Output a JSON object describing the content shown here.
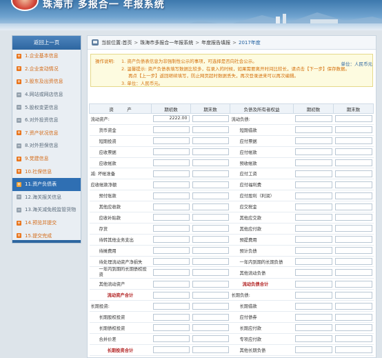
{
  "header": {
    "title": "珠海市 多报合一 年报系统"
  },
  "sidebar": {
    "title": "返回上一页",
    "items": [
      {
        "label": "1.企业基本信息",
        "state": "done"
      },
      {
        "label": "2.企业变动情况",
        "state": "done"
      },
      {
        "label": "3.股东及出资信息",
        "state": "done"
      },
      {
        "label": "4.网站或网店信息",
        "state": "todo"
      },
      {
        "label": "5.股权变更信息",
        "state": "todo"
      },
      {
        "label": "6.对外投资信息",
        "state": "todo"
      },
      {
        "label": "7.资产状况信息",
        "state": "done"
      },
      {
        "label": "8.对外担保信息",
        "state": "todo"
      },
      {
        "label": "9.党建信息",
        "state": "done"
      },
      {
        "label": "10.社保信息",
        "state": "done"
      },
      {
        "label": "11.资产负债表",
        "state": "active"
      },
      {
        "label": "12.海关报关信息",
        "state": "todo"
      },
      {
        "label": "13.海关减免税监管货物",
        "state": "todo"
      },
      {
        "label": "14.预览并提交",
        "state": "done"
      },
      {
        "label": "15.提交完成",
        "state": "done"
      }
    ]
  },
  "breadcrumb": {
    "prefix": "当前位置:",
    "items": [
      "首页",
      "珠海市多报合一年报系统",
      "年度报告填报",
      "2017年度"
    ]
  },
  "notice": {
    "label": "操作说明:",
    "lines": [
      "1. 资产负债表信息为非强制性公示的事项，可选择是否向社会公示。",
      "2. 温馨提示: 资产负债表填写数据比较多，在录入的时候，如果需要离开时间比较长，请点击【下一步】保存数据。",
      "再点【上一步】返回继续填写，防止网页超时数据丢失，再次登录进来可以再次编辑。",
      "3. 单位：人民币元。"
    ]
  },
  "unit_label": "单位：人民币元",
  "table": {
    "headers": [
      "资　　　产",
      "期初数",
      "期末数",
      "负债及所有者权益",
      "期初数",
      "期末数"
    ],
    "rows": [
      {
        "left": "流动资产:",
        "lstyle": "",
        "lv1": "2222.00",
        "lv2": "",
        "right": "流动负债:",
        "rstyle": ""
      },
      {
        "left": "货币资金",
        "lstyle": "ind",
        "lv1": "",
        "lv2": "",
        "right": "短期借款",
        "rstyle": "ind"
      },
      {
        "left": "短期投资",
        "lstyle": "ind",
        "lv1": "",
        "lv2": "",
        "right": "应付票据",
        "rstyle": "ind"
      },
      {
        "left": "应收票据",
        "lstyle": "ind",
        "lv1": "",
        "lv2": "",
        "right": "应付帐款",
        "rstyle": "ind"
      },
      {
        "left": "应收帐款",
        "lstyle": "ind",
        "lv1": "",
        "lv2": "",
        "right": "预收帐款",
        "rstyle": "ind"
      },
      {
        "left": "减: 坏帐准备",
        "lstyle": "",
        "lv1": "",
        "lv2": "",
        "right": "应付工资",
        "rstyle": "ind"
      },
      {
        "left": "应收帐款净额",
        "lstyle": "",
        "lv1": "",
        "lv2": "",
        "right": "应付福利费",
        "rstyle": "ind"
      },
      {
        "left": "预付账款",
        "lstyle": "ind",
        "lv1": "",
        "lv2": "",
        "right": "应付股利（利润）",
        "rstyle": "ind"
      },
      {
        "left": "其他应收款",
        "lstyle": "ind",
        "lv1": "",
        "lv2": "",
        "right": "应交税金",
        "rstyle": "ind"
      },
      {
        "left": "应收补贴款",
        "lstyle": "ind",
        "lv1": "",
        "lv2": "",
        "right": "其他应交款",
        "rstyle": "ind"
      },
      {
        "left": "存货",
        "lstyle": "ind",
        "lv1": "",
        "lv2": "",
        "right": "其他应付款",
        "rstyle": "ind"
      },
      {
        "left": "待转其他业务支出",
        "lstyle": "ind",
        "lv1": "",
        "lv2": "",
        "right": "预提费用",
        "rstyle": "ind"
      },
      {
        "left": "待摊费用",
        "lstyle": "ind",
        "lv1": "",
        "lv2": "",
        "right": "预计负债",
        "rstyle": "ind"
      },
      {
        "left": "待处理流动资产净损失",
        "lstyle": "ind",
        "lv1": "",
        "lv2": "",
        "right": "一年内到期的长期负债",
        "rstyle": "ind"
      },
      {
        "left": "一年内到期的长期债权投资",
        "lstyle": "ind wrap",
        "lv1": "",
        "lv2": "",
        "right": "其他流动负债",
        "rstyle": "ind"
      },
      {
        "left": "其他流动资产",
        "lstyle": "ind",
        "lv1": "",
        "lv2": "",
        "right": "流动负债合计",
        "rstyle": "boldr red"
      },
      {
        "left": "流动资产合计",
        "lstyle": "bold red",
        "lv1": "",
        "lv2": "",
        "right": "长期负债:",
        "rstyle": ""
      },
      {
        "left": "长期投资:",
        "lstyle": "",
        "lv1": "",
        "lv2": "",
        "right": "长期借款",
        "rstyle": "ind"
      },
      {
        "left": "长期股权投资",
        "lstyle": "ind",
        "lv1": "",
        "lv2": "",
        "right": "应付债券",
        "rstyle": "ind"
      },
      {
        "left": "长期债权投资",
        "lstyle": "ind",
        "lv1": "",
        "lv2": "",
        "right": "长期应付款",
        "rstyle": "ind"
      },
      {
        "left": "合并价差",
        "lstyle": "ind",
        "lv1": "",
        "lv2": "",
        "right": "专项应付款",
        "rstyle": "ind"
      },
      {
        "left": "长期投资合计",
        "lstyle": "bold red",
        "lv1": "",
        "lv2": "",
        "right": "其他长期负债",
        "rstyle": "ind"
      }
    ]
  }
}
